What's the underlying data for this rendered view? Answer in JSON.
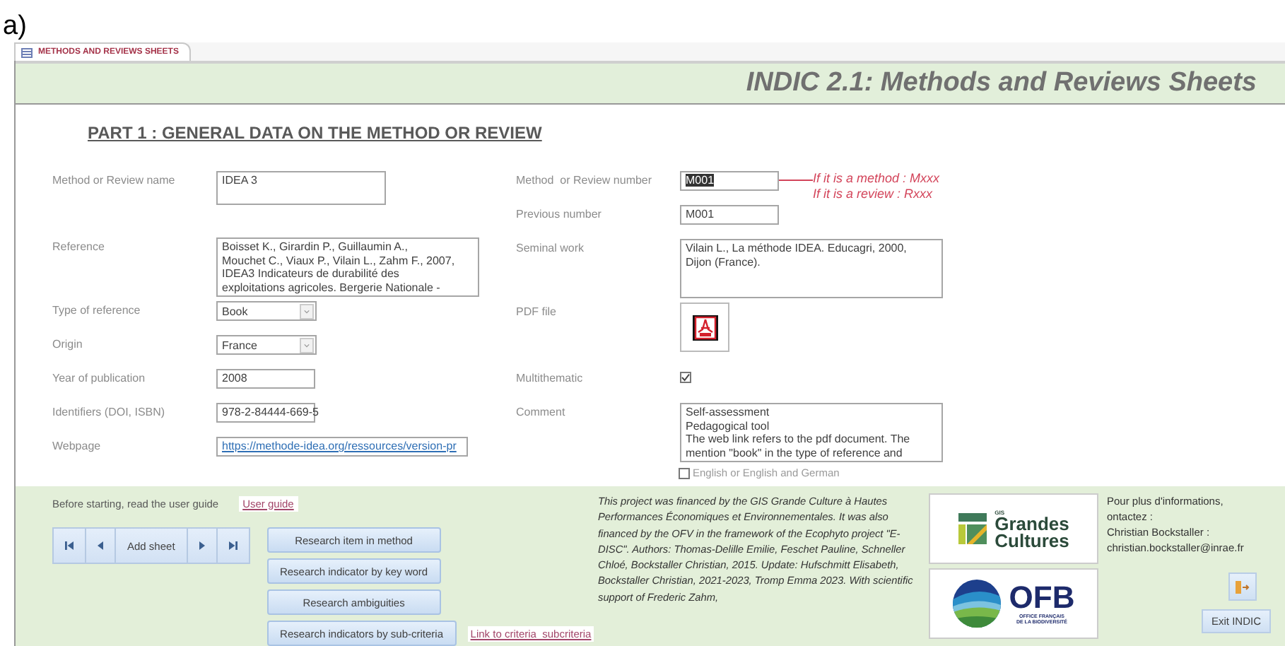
{
  "figure_label": "a)",
  "tabs": [
    {
      "label": "METHODS AND REVIEWS SHEETS",
      "selected": true
    }
  ],
  "header": {
    "title": "INDIC 2.1: Methods and Reviews Sheets"
  },
  "section_heading": "PART 1 : GENERAL DATA ON THE METHOD OR REVIEW",
  "left_fields": [
    {
      "kind": "note",
      "label": "Method or Review name",
      "lines": [
        "IDEA 3"
      ]
    },
    {
      "kind": "memo",
      "label": "Reference",
      "lines": [
        "Boisset K., Girardin P., Guillaumin A.,",
        "Mouchet C., Viaux P., Vilain L., Zahm F., 2007,",
        "IDEA3 Indicateurs de durabilité des",
        "exploitations agricoles. Bergerie Nationale -"
      ]
    },
    {
      "kind": "combo",
      "label": "Type of reference",
      "value": "Book"
    },
    {
      "kind": "combo",
      "label": "Origin",
      "value": "France"
    },
    {
      "kind": "text",
      "label": "Year of publication",
      "value": "2008"
    },
    {
      "kind": "text",
      "label": "Identifiers (DOI, ISBN)",
      "value": "978-2-84444-669-5"
    },
    {
      "kind": "link",
      "label": "Webpage",
      "value": "https://methode-idea.org/ressources/version-pr"
    }
  ],
  "right_fields": [
    {
      "kind": "text",
      "label": "Method  or Review number",
      "value": "M001",
      "text_selected": true,
      "annotation": [
        "If it is a method : Mxxx",
        "If it is a review : Rxxx"
      ]
    },
    {
      "kind": "text",
      "label": "Previous number",
      "value": "M001"
    },
    {
      "kind": "memo",
      "label": "Seminal work",
      "lines": [
        "Vilain L., La méthode IDEA. Educagri, 2000,",
        "Dijon (France)."
      ]
    },
    {
      "kind": "pdf",
      "label": "PDF file"
    },
    {
      "kind": "check",
      "label": "Multithematic",
      "checked": true
    },
    {
      "kind": "memo",
      "label": "Comment",
      "lines": [
        "Self-assessment",
        "Pedagogical tool",
        "The web link refers to the pdf document. The",
        "mention \"book\" in the type of reference and"
      ]
    },
    {
      "kind": "check-inline",
      "text": "English or English and German",
      "checked": false
    }
  ],
  "footer": {
    "guide_text": "Before starting, read the user guide",
    "guide_link": "User guide",
    "navigation": [
      {
        "kind": "first"
      },
      {
        "kind": "prev"
      },
      {
        "kind": "label",
        "text": "Add sheet"
      },
      {
        "kind": "next"
      },
      {
        "kind": "last"
      }
    ],
    "search_buttons": [
      "Research item in method",
      "Research indicator by key word",
      "Research ambiguities",
      "Research indicators by sub-criteria"
    ],
    "criteria_link": "Link to criteria_subcriteria",
    "credits": "This project was financed by the GIS Grande Culture à Hautes Performances Économiques et Environnementales. It was also financed by the OFV in the framework of the Ecophyto project \"E-DISC\". Authors: Thomas-Delille Emilie, Feschet Pauline, Schneller Chloé, Bockstaller Christian, 2015. Update: Hufschmitt Elisabeth, Bockstaller Christian, 2021-2023, Tromp Emma 2023. With scientific support of Frederic Zahm,",
    "logo_grandes": {
      "small": "GIS",
      "line1": "Grandes",
      "line2": "Cultures"
    },
    "logo_ofb": {
      "name": "OFB",
      "line1": "OFFICE FRANÇAIS",
      "line2": "DE LA BIODIVERSITÉ"
    },
    "contact_lines": [
      "Pour plus d'informations,",
      "ontactez :",
      "Christian Bockstaller :",
      "christian.bockstaller@inrae.fr"
    ],
    "exit_button": "Exit INDIC"
  }
}
